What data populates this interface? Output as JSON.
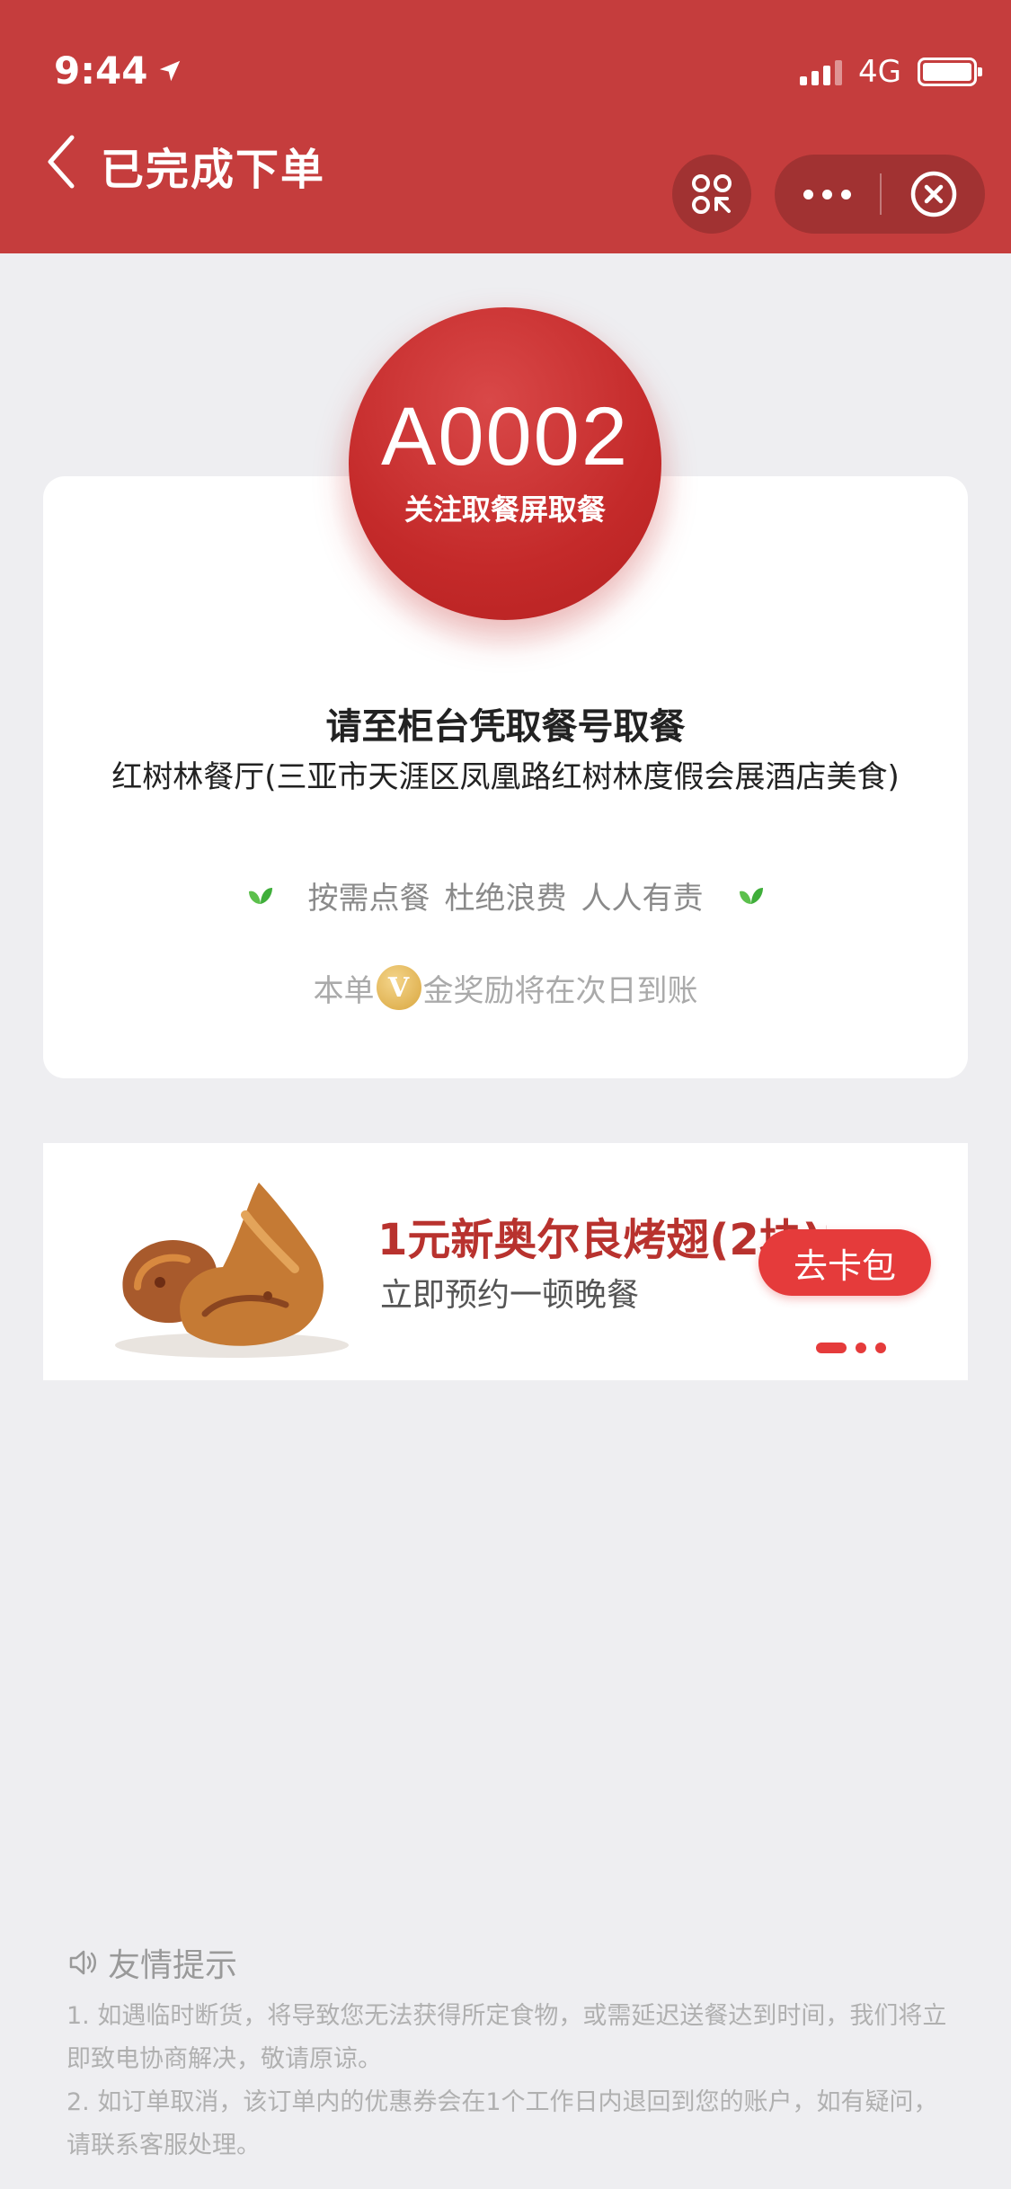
{
  "status_bar": {
    "time": "9:44",
    "network": "4G"
  },
  "nav": {
    "title": "已完成下单"
  },
  "order": {
    "number": "A0002",
    "number_hint": "关注取餐屏取餐",
    "instruction": "请至柜台凭取餐号取餐",
    "restaurant": "红树林餐厅(三亚市天涯区凤凰路红树林度假会展酒店美食)",
    "slogan": [
      "按需点餐",
      "杜绝浪费",
      "人人有责"
    ],
    "reward_prefix": "本单",
    "coin_letter": "V",
    "reward_suffix": "金奖励将在次日到账"
  },
  "promo": {
    "title": "1元新奥尔良烤翅(2块)券",
    "subtitle": "立即预约一顿晚餐",
    "button": "去卡包",
    "image": "roasted-chicken-wings"
  },
  "tips": {
    "title": "友情提示",
    "items": [
      "1. 如遇临时断货，将导致您无法获得所定食物，或需延迟送餐达到时间，我们将立即致电协商解决，敬请原谅。",
      "2. 如订单取消，该订单内的优惠券会在1个工作日内退回到您的账户，如有疑问，请联系客服处理。"
    ]
  },
  "colors": {
    "header": "#c53d3d",
    "accent": "#e53b3b",
    "promo_title": "#b8322e"
  }
}
